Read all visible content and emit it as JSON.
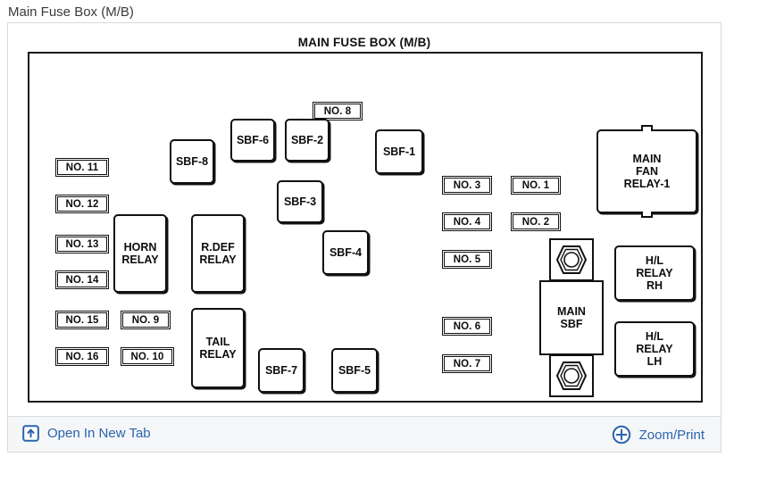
{
  "page": {
    "title": "Main Fuse Box (M/B)"
  },
  "diagram": {
    "title": "MAIN FUSE BOX (M/B)",
    "components": [
      {
        "id": "sbf-6",
        "label": "SBF-6",
        "kind": "sbf"
      },
      {
        "id": "sbf-2",
        "label": "SBF-2",
        "kind": "sbf"
      },
      {
        "id": "sbf-1",
        "label": "SBF-1",
        "kind": "sbf"
      },
      {
        "id": "sbf-8",
        "label": "SBF-8",
        "kind": "sbf"
      },
      {
        "id": "sbf-3",
        "label": "SBF-3",
        "kind": "sbf"
      },
      {
        "id": "sbf-4",
        "label": "SBF-4",
        "kind": "sbf"
      },
      {
        "id": "sbf-7",
        "label": "SBF-7",
        "kind": "sbf"
      },
      {
        "id": "sbf-5",
        "label": "SBF-5",
        "kind": "sbf"
      },
      {
        "id": "horn-relay",
        "label": "HORN\nRELAY",
        "kind": "relay"
      },
      {
        "id": "rdef-relay",
        "label": "R.DEF\nRELAY",
        "kind": "relay"
      },
      {
        "id": "tail-relay",
        "label": "TAIL\nRELAY",
        "kind": "relay"
      },
      {
        "id": "main-fan-relay-1",
        "label": "MAIN\nFAN\nRELAY-1",
        "kind": "relay"
      },
      {
        "id": "hl-relay-rh",
        "label": "H/L\nRELAY\nRH",
        "kind": "relay"
      },
      {
        "id": "hl-relay-lh",
        "label": "H/L\nRELAY\nLH",
        "kind": "relay"
      },
      {
        "id": "main-sbf",
        "label": "MAIN\nSBF",
        "kind": "plainbox"
      }
    ],
    "fuses": [
      {
        "id": "no-8",
        "label": "NO. 8"
      },
      {
        "id": "no-11",
        "label": "NO. 11"
      },
      {
        "id": "no-12",
        "label": "NO. 12"
      },
      {
        "id": "no-13",
        "label": "NO. 13"
      },
      {
        "id": "no-14",
        "label": "NO. 14"
      },
      {
        "id": "no-15",
        "label": "NO. 15"
      },
      {
        "id": "no-16",
        "label": "NO. 16"
      },
      {
        "id": "no-9",
        "label": "NO. 9"
      },
      {
        "id": "no-10",
        "label": "NO. 10"
      },
      {
        "id": "no-3",
        "label": "NO. 3"
      },
      {
        "id": "no-4",
        "label": "NO. 4"
      },
      {
        "id": "no-5",
        "label": "NO. 5"
      },
      {
        "id": "no-6",
        "label": "NO. 6"
      },
      {
        "id": "no-7",
        "label": "NO. 7"
      },
      {
        "id": "no-1",
        "label": "NO. 1"
      },
      {
        "id": "no-2",
        "label": "NO. 2"
      }
    ]
  },
  "toolbar": {
    "open_new_tab_label": "Open In New Tab",
    "open_new_tab_icon": "open-in-new-tab-icon",
    "zoom_print_label": "Zoom/Print",
    "zoom_print_icon": "circle-plus-icon",
    "link_color": "#2b63ad",
    "background": "#f4f6f8"
  },
  "colors": {
    "page_background": "#ffffff",
    "panel_border": "#d8d8d8",
    "diagram_stroke": "#111111",
    "title_text": "#3a3a3a"
  }
}
